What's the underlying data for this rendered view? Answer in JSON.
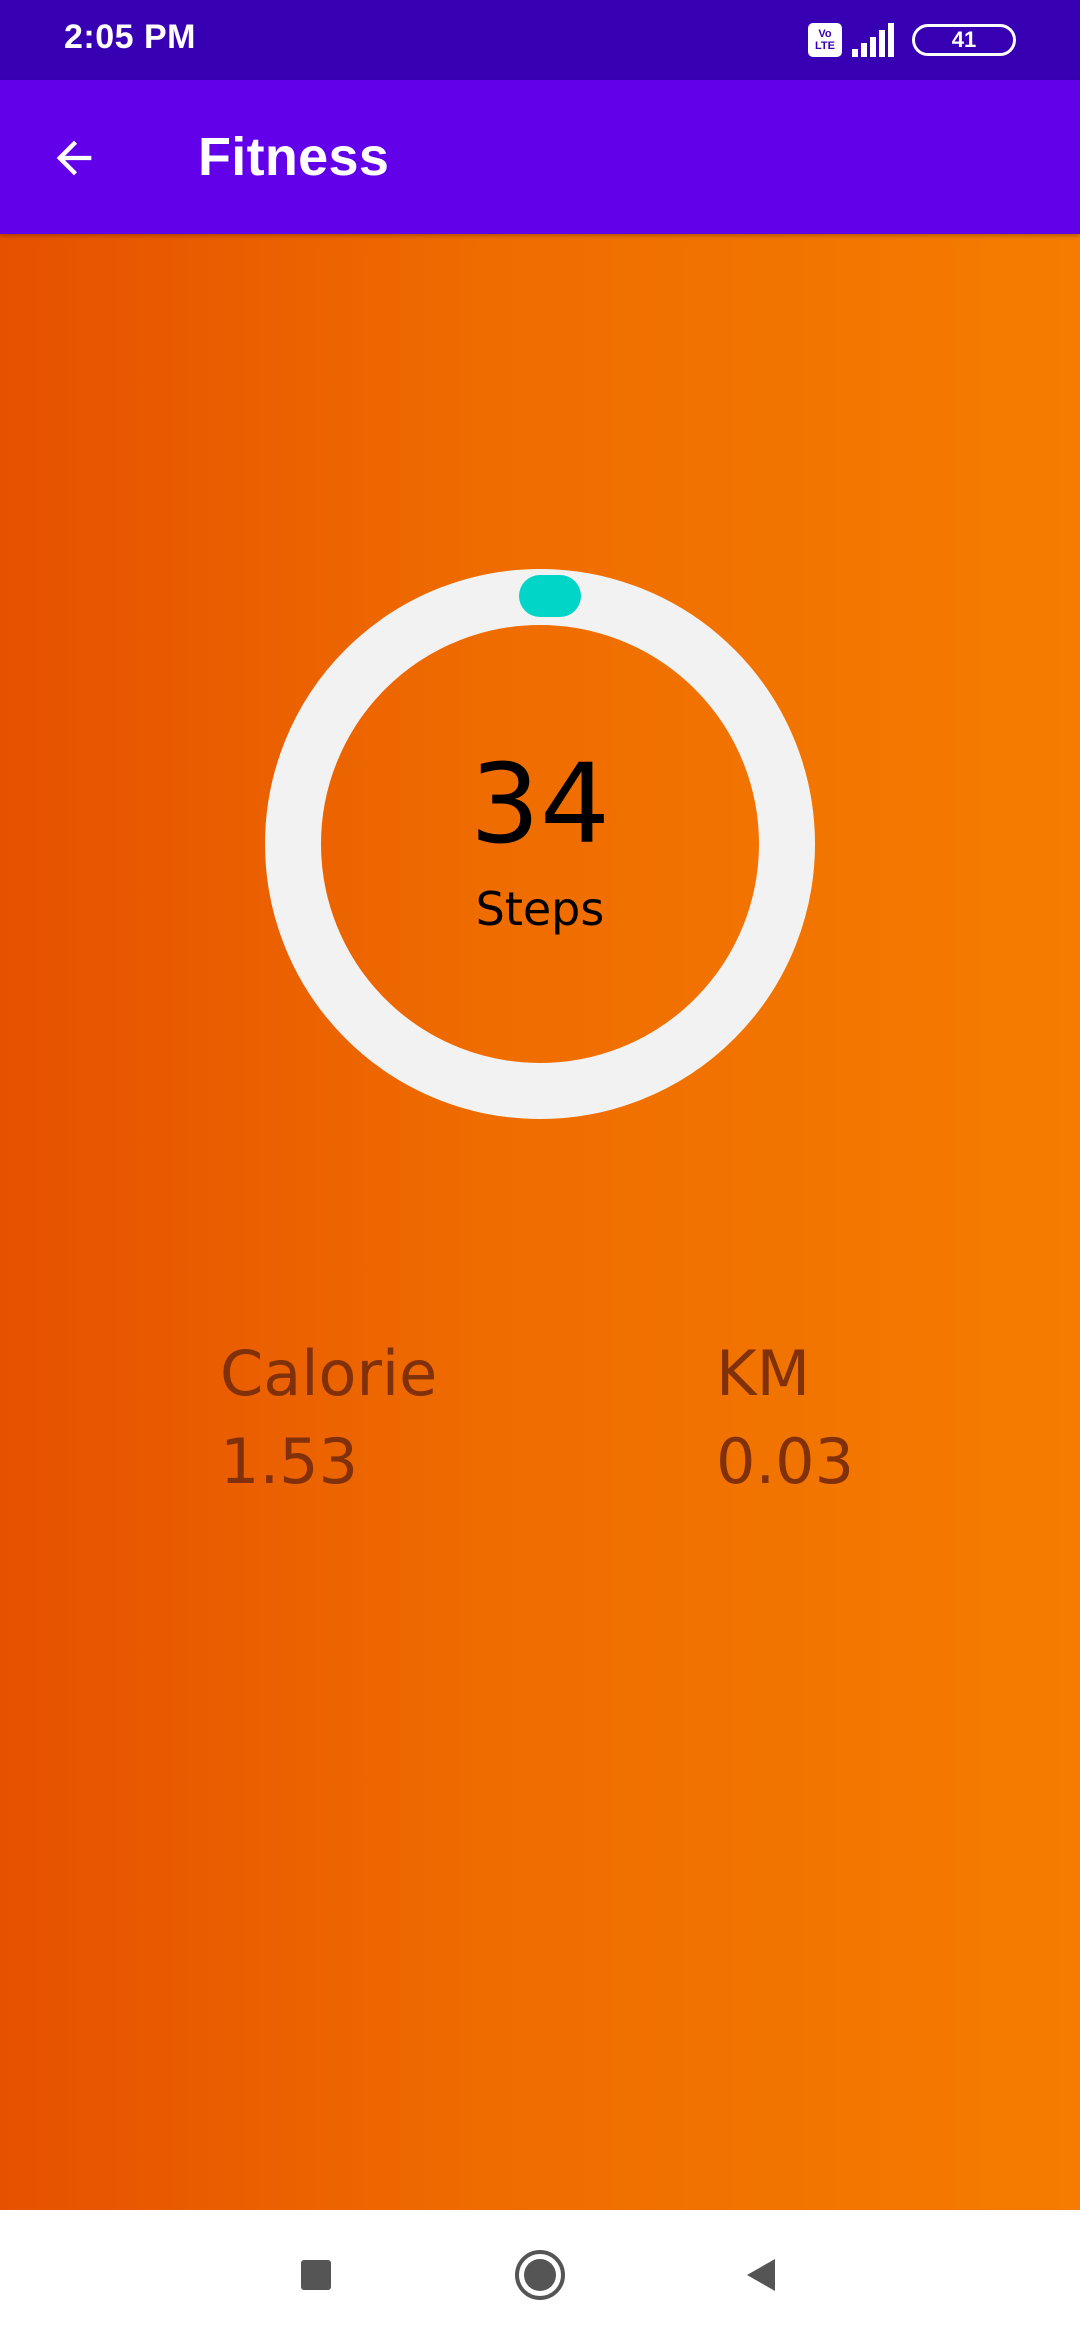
{
  "status_bar": {
    "time": "2:05 PM",
    "volte_line1": "Vo",
    "volte_line2": "LTE",
    "battery_level": "41"
  },
  "app_bar": {
    "title": "Fitness",
    "back_icon": "arrow-left-icon"
  },
  "progress": {
    "steps_value": "34",
    "steps_label": "Steps",
    "ring_track_color": "#f2f2f2",
    "ring_indicator_color": "#00d5c7",
    "progress_fraction": 0.0
  },
  "stats": {
    "calorie_label": "Calorie",
    "calorie_value": "1.53",
    "km_label": "KM",
    "km_value": "0.03"
  },
  "colors": {
    "status_bar": "#3700b3",
    "app_bar": "#6200ea",
    "gradient_start": "#e65100",
    "gradient_end": "#f57c00",
    "stat_text": "#80300a"
  },
  "nav_bar": {
    "recent_icon": "square-icon",
    "home_icon": "circle-icon",
    "back_icon": "triangle-back-icon"
  }
}
